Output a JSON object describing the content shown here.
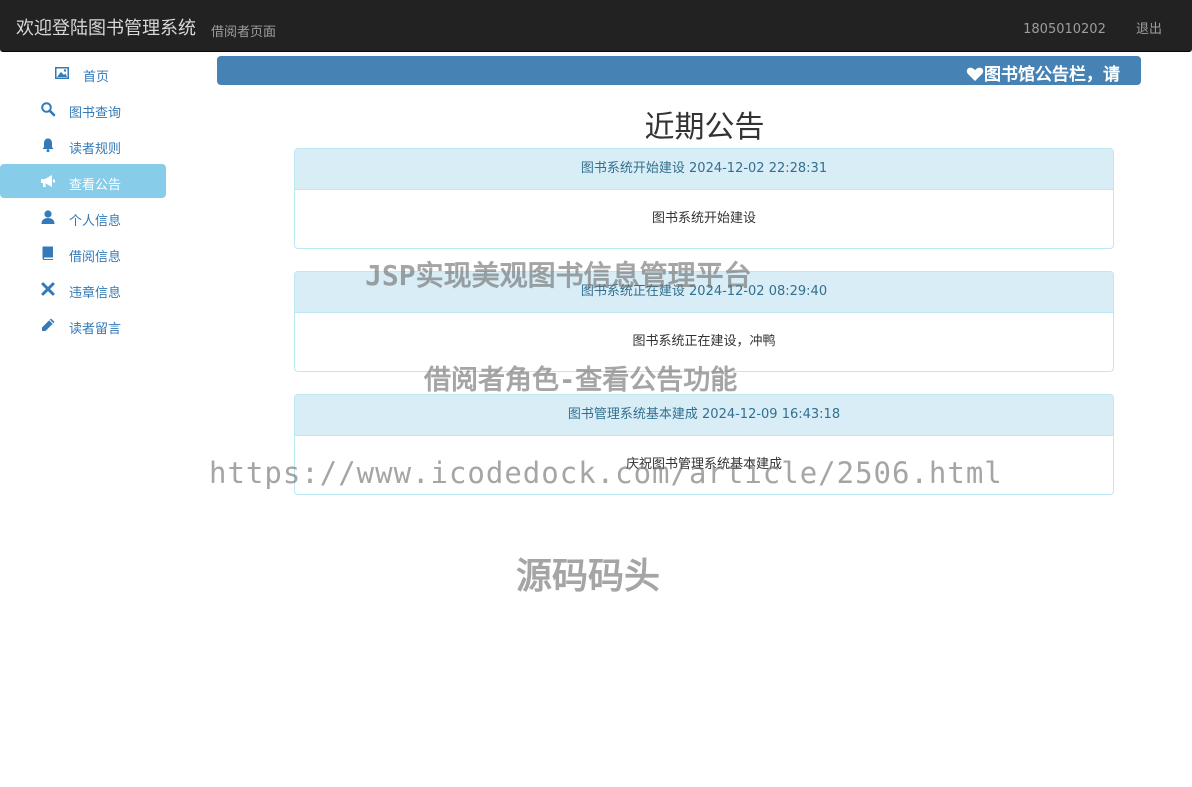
{
  "header": {
    "brand": "欢迎登陆图书管理系统",
    "subtitle": "借阅者页面",
    "user_id": "1805010202",
    "logout": "退出"
  },
  "sidebar": {
    "items": [
      {
        "label": "首页",
        "icon": "picture-icon"
      },
      {
        "label": "图书查询",
        "icon": "search-icon"
      },
      {
        "label": "读者规则",
        "icon": "bell-icon"
      },
      {
        "label": "查看公告",
        "icon": "bullhorn-icon",
        "active": true
      },
      {
        "label": "个人信息",
        "icon": "user-icon"
      },
      {
        "label": "借阅信息",
        "icon": "book-icon"
      },
      {
        "label": "违章信息",
        "icon": "remove-icon"
      },
      {
        "label": "读者留言",
        "icon": "pencil-icon"
      }
    ]
  },
  "marquee": {
    "text": "图书馆公告栏，请"
  },
  "main": {
    "title": "近期公告",
    "notices": [
      {
        "heading": "图书系统开始建设 2024-12-02 22:28:31",
        "body": "图书系统开始建设"
      },
      {
        "heading": "图书系统正在建设 2024-12-02 08:29:40",
        "body": "图书系统正在建设，冲鸭"
      },
      {
        "heading": "图书管理系统基本建成 2024-12-09 16:43:18",
        "body": "庆祝图书管理系统基本建成"
      }
    ]
  },
  "watermarks": {
    "line1": "JSP实现美观图书信息管理平台",
    "line2": "借阅者角色-查看公告功能",
    "line3": "https://www.icodedock.com/article/2506.html",
    "line4": "源码码头"
  },
  "colors": {
    "navbar": "#222222",
    "accent": "#337ab7",
    "active_item": "#87cde9",
    "marquee": "#4682b4",
    "panel_heading": "#d9edf7",
    "panel_border": "#bce8f1"
  }
}
